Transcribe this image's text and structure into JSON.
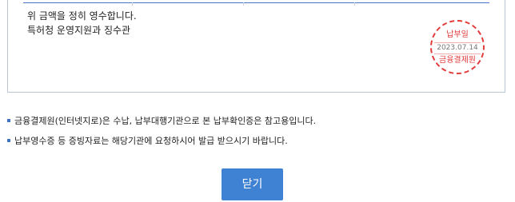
{
  "receipt": {
    "line1": "위 금액을 정히 영수합니다.",
    "line2": "특허청 운영지원과 징수관"
  },
  "stamp": {
    "title": "납부일",
    "date": "2023.07.14",
    "issuer": "금융결제원",
    "color": "#e23b3b"
  },
  "notes": [
    "금융결제원(인터넷지로)은 수납, 납부대행기관으로 본 납부확인증은 참고용입니다.",
    "납부영수증 등 증빙자료는 해당기관에 요청하시어 발급 받으시기 바랍니다."
  ],
  "actions": {
    "close_label": "닫기",
    "button_color": "#3f82d3"
  },
  "colors": {
    "accent": "#4a76c8",
    "bullet": "#3f73c3"
  }
}
